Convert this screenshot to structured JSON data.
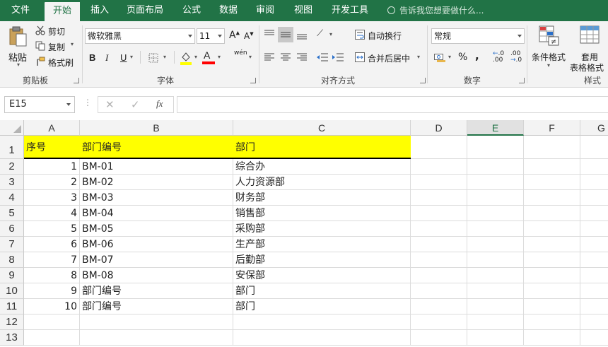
{
  "tabs": [
    {
      "label": "文件",
      "active": false
    },
    {
      "label": "开始",
      "active": true
    },
    {
      "label": "插入",
      "active": false
    },
    {
      "label": "页面布局",
      "active": false
    },
    {
      "label": "公式",
      "active": false
    },
    {
      "label": "数据",
      "active": false
    },
    {
      "label": "审阅",
      "active": false
    },
    {
      "label": "视图",
      "active": false
    },
    {
      "label": "开发工具",
      "active": false
    }
  ],
  "tellme": "告诉我您想要做什么...",
  "clipboard": {
    "paste": "粘贴",
    "cut": "剪切",
    "copy": "复制",
    "format_painter": "格式刷",
    "group": "剪贴板"
  },
  "font": {
    "name": "微软雅黑",
    "size": "11",
    "bold": "B",
    "italic": "I",
    "underline": "U",
    "group": "字体",
    "phonetic": "wén",
    "grow": "A",
    "shrink": "A",
    "font_color_letter": "A"
  },
  "alignment": {
    "wrap": "自动换行",
    "merge": "合并后居中",
    "group": "对齐方式"
  },
  "number": {
    "format": "常规",
    "percent": "%",
    "comma": ",",
    "inc_dec": ".00",
    "group": "数字"
  },
  "styles": {
    "conditional": "条件格式",
    "table_format": "套用\n表格格式",
    "table_format_1": "套用",
    "table_format_2": "表格格式",
    "group": "样式"
  },
  "formula_bar": {
    "name_box": "E15",
    "fx": "fx",
    "value": ""
  },
  "colors": {
    "brand": "#217346",
    "header_fill": "#ffff00",
    "font_color": "#ff0000",
    "fill_color": "#ffff00"
  },
  "columns": [
    "A",
    "B",
    "C",
    "D",
    "E",
    "F",
    "G"
  ],
  "selected_column": "E",
  "rows": [
    {
      "n": "1",
      "a": "序号",
      "b": "部门编号",
      "c": "部门"
    },
    {
      "n": "2",
      "a": "1",
      "b": "BM-01",
      "c": "综合办"
    },
    {
      "n": "3",
      "a": "2",
      "b": "BM-02",
      "c": "人力资源部"
    },
    {
      "n": "4",
      "a": "3",
      "b": "BM-03",
      "c": "财务部"
    },
    {
      "n": "5",
      "a": "4",
      "b": "BM-04",
      "c": "销售部"
    },
    {
      "n": "6",
      "a": "5",
      "b": "BM-05",
      "c": "采购部"
    },
    {
      "n": "7",
      "a": "6",
      "b": "BM-06",
      "c": "生产部"
    },
    {
      "n": "8",
      "a": "7",
      "b": "BM-07",
      "c": "后勤部"
    },
    {
      "n": "9",
      "a": "8",
      "b": "BM-08",
      "c": "安保部"
    },
    {
      "n": "10",
      "a": "9",
      "b": "部门编号",
      "c": "部门"
    },
    {
      "n": "11",
      "a": "10",
      "b": "部门编号",
      "c": "部门"
    },
    {
      "n": "12",
      "a": "",
      "b": "",
      "c": ""
    },
    {
      "n": "13",
      "a": "",
      "b": "",
      "c": ""
    }
  ]
}
